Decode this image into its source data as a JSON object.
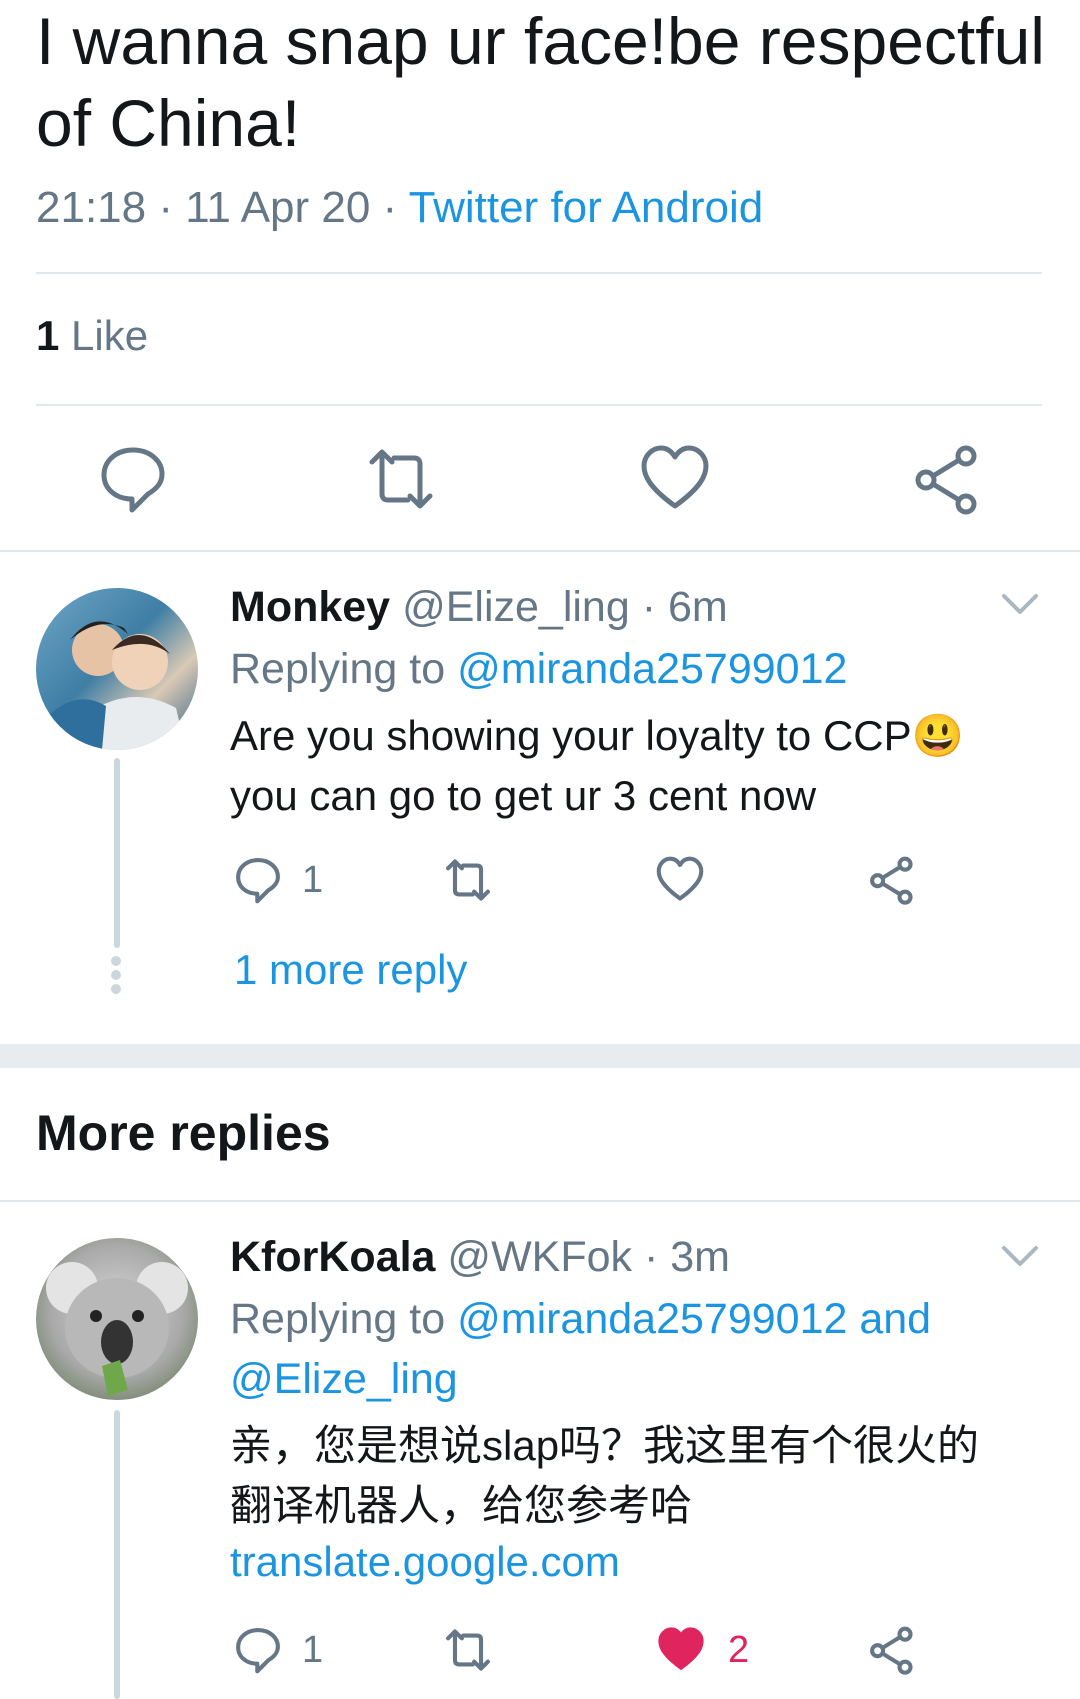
{
  "main_tweet": {
    "text": "I wanna snap ur face!be respectful of China!",
    "time": "21:18",
    "date": "11 Apr 20",
    "source": "Twitter for Android",
    "likes_count": "1",
    "likes_label": "Like"
  },
  "icons": {
    "reply": "reply-icon",
    "retweet": "retweet-icon",
    "like": "heart-icon",
    "share": "share-icon",
    "chevron": "chevron-down-icon"
  },
  "colors": {
    "accent": "#1b95e0",
    "like_active": "#e0245e",
    "muted": "#657786"
  },
  "replies": [
    {
      "name": "Monkey",
      "handle": "@Elize_ling",
      "time": "· 6m",
      "replying_prefix": "Replying to",
      "replying_to": "@miranda25799012",
      "replying_to_2": "",
      "text_line1": "Are you showing your loyalty to CCP😃",
      "text_line2": "you can go to get ur 3 cent now",
      "reply_count": "1",
      "like_count": "",
      "more_replies": "1 more reply"
    }
  ],
  "more_replies_heading": "More replies",
  "more": [
    {
      "name": "KforKoala",
      "handle": "@WKFok",
      "time": "· 3m",
      "replying_prefix": "Replying to",
      "replying_to": "@miranda25799012 and",
      "replying_to_2": "@Elize_ling",
      "text_line1": "亲，您是想说slap吗？我这里有个很火的",
      "text_line2": "翻译机器人，给您参考哈",
      "link": "translate.google.com",
      "reply_count": "1",
      "like_count": "2",
      "liked": true
    }
  ]
}
